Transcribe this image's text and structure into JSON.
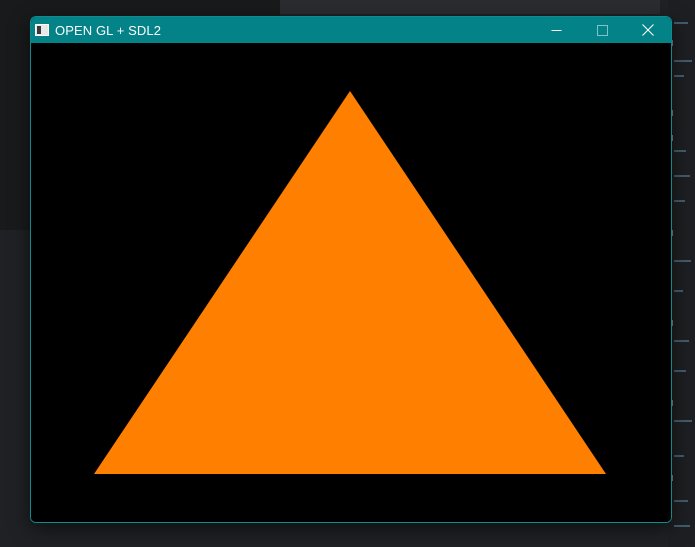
{
  "window": {
    "title": "OPEN GL + SDL2",
    "titlebar_color": "#038387",
    "border_color": "#0f8a8e",
    "controls": {
      "minimize_icon": "minimize-icon",
      "maximize_icon": "maximize-icon",
      "close_icon": "close-icon"
    }
  },
  "scene": {
    "background_color": "#000000",
    "shape": "triangle",
    "fill_color": "#ff7f00"
  }
}
